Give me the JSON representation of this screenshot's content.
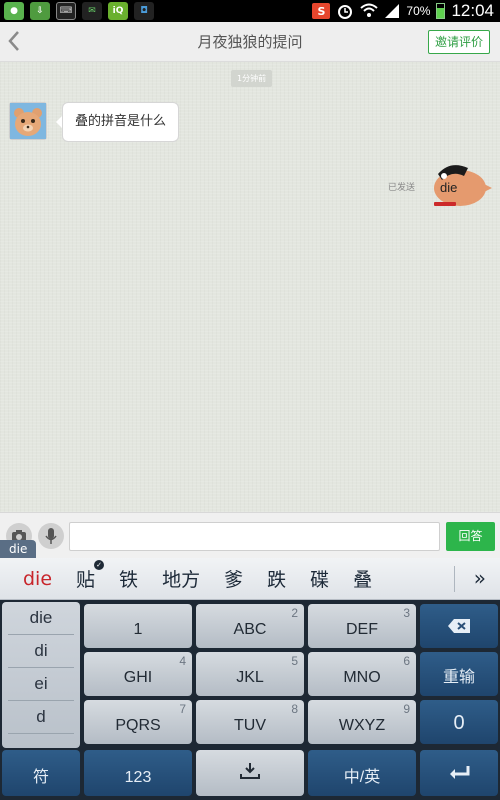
{
  "status_bar": {
    "battery": "70%",
    "clock": "12:04",
    "notification_icons": [
      "wechat-icon",
      "download-icon",
      "keyboard-icon",
      "chat-icon",
      "iqiyi-icon",
      "bag-icon"
    ],
    "tray_icons": [
      "sogou-icon",
      "alarm-icon",
      "wifi-icon",
      "signal-icon",
      "battery-icon"
    ]
  },
  "header": {
    "back_icon": "chevron-left-icon",
    "title": "月夜独狼的提问",
    "rate_button": "邀请评价"
  },
  "chat": {
    "time_label": "1分钟前",
    "incoming": {
      "text": "叠的拼音是什么",
      "avatar": "cartoon-bear-avatar"
    },
    "outgoing": {
      "status": "已发送",
      "sticker_text": "die"
    }
  },
  "input_bar": {
    "camera_icon": "camera-icon",
    "mic_icon": "microphone-icon",
    "input_value": "",
    "answer_button": "回答",
    "composing_text": "die"
  },
  "candidates": {
    "items": [
      "die",
      "贴",
      "铁",
      "地方",
      "爹",
      "跌",
      "碟",
      "叠"
    ],
    "more_icon": "»"
  },
  "keyboard": {
    "pinyin_options": [
      "die",
      "di",
      "ei",
      "d"
    ],
    "keys": [
      {
        "label": "1",
        "num": ""
      },
      {
        "label": "ABC",
        "num": "2"
      },
      {
        "label": "DEF",
        "num": "3"
      },
      {
        "label": "GHI",
        "num": "4"
      },
      {
        "label": "JKL",
        "num": "5"
      },
      {
        "label": "MNO",
        "num": "6"
      },
      {
        "label": "PQRS",
        "num": "7"
      },
      {
        "label": "TUV",
        "num": "8"
      },
      {
        "label": "WXYZ",
        "num": "9"
      }
    ],
    "reenter": "重输",
    "zero": "0",
    "symbol": "符",
    "num_switch": "123",
    "lang_switch": "中/英"
  }
}
